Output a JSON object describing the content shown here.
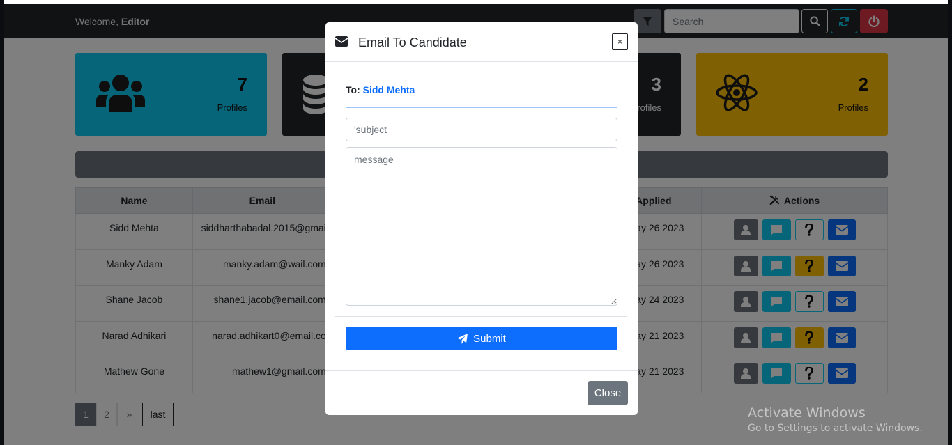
{
  "navbar": {
    "welcome_prefix": "Welcome,",
    "welcome_user": "Editor",
    "search_placeholder": "Search"
  },
  "cards": [
    {
      "count": "7",
      "label": "Profiles",
      "icon": "users-icon",
      "color": "#0dcaf0"
    },
    {
      "count": "",
      "label": "",
      "icon": "database-icon",
      "color": "#212529"
    },
    {
      "count": "3",
      "label": "rofiles",
      "icon": "",
      "color": "#212529"
    },
    {
      "count": "2",
      "label": "Profiles",
      "icon": "react-atom-icon",
      "color": "#ffc107"
    }
  ],
  "table": {
    "headers": [
      "Name",
      "Email",
      "Applied",
      "Actions"
    ],
    "rows": [
      {
        "name": "Sidd Mehta",
        "email": "siddharthabadal.2015@gmai",
        "applied": "ay 26 2023"
      },
      {
        "name": "Manky Adam",
        "email": "manky.adam@wail.com",
        "applied": "ay 26 2023"
      },
      {
        "name": "Shane Jacob",
        "email": "shane1.jacob@email.com",
        "applied": "ay 24 2023"
      },
      {
        "name": "Narad Adhikari",
        "email": "narad.adhikart0@email.co",
        "applied": "ay 21 2023"
      },
      {
        "name": "Mathew Gone",
        "email": "mathew1@gmail.com",
        "applied": "ay 21 2023"
      }
    ]
  },
  "pagination": {
    "pages": [
      "1",
      "2"
    ],
    "next": "»",
    "last": "last"
  },
  "modal": {
    "title": "Email To Candidate",
    "close_x": "×",
    "to_label": "To:",
    "to_name": "Sidd Mehta",
    "subject_placeholder": "'subject",
    "message_placeholder": "message",
    "submit_label": "Submit",
    "close_label": "Close"
  },
  "watermark": {
    "line1": "Activate Windows",
    "line2": "Go to Settings to activate Windows."
  },
  "colors": {
    "primary": "#0d6efd",
    "info": "#0dcaf0",
    "warning": "#ffc107",
    "danger": "#dc3545",
    "dark": "#212529",
    "secondary": "#6c757d"
  }
}
